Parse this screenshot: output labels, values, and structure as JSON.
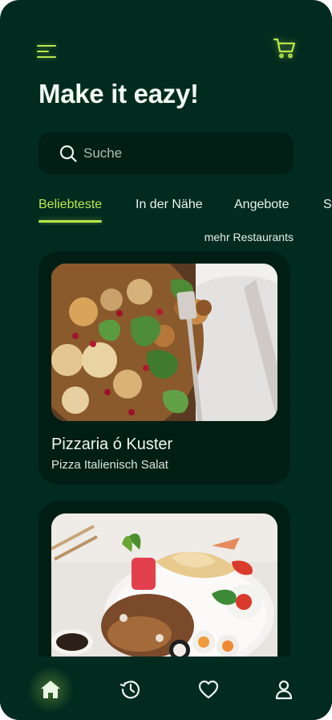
{
  "header": {
    "title": "Make it eazy!",
    "menu_icon": "menu-icon",
    "cart_icon": "cart-icon",
    "accent_color": "#b9e84b",
    "background_color": "#022b1f"
  },
  "search": {
    "placeholder": "Suche",
    "value": "",
    "icon": "search-icon"
  },
  "tabs": [
    {
      "label": "Beliebteste",
      "active": true
    },
    {
      "label": "In der Nähe",
      "active": false
    },
    {
      "label": "Angebote",
      "active": false
    },
    {
      "label": "S",
      "active": false
    }
  ],
  "more_link": "mehr Restaurants",
  "restaurants": [
    {
      "name": "Pizzaria ó Kuster",
      "subtitle": "Pizza Italienisch Salat",
      "image": "salad-photo"
    },
    {
      "name": "",
      "subtitle": "",
      "image": "sushi-platter-photo"
    }
  ],
  "bottom_nav": [
    {
      "icon": "home-icon",
      "active": true
    },
    {
      "icon": "history-icon",
      "active": false
    },
    {
      "icon": "heart-icon",
      "active": false
    },
    {
      "icon": "user-icon",
      "active": false
    }
  ]
}
